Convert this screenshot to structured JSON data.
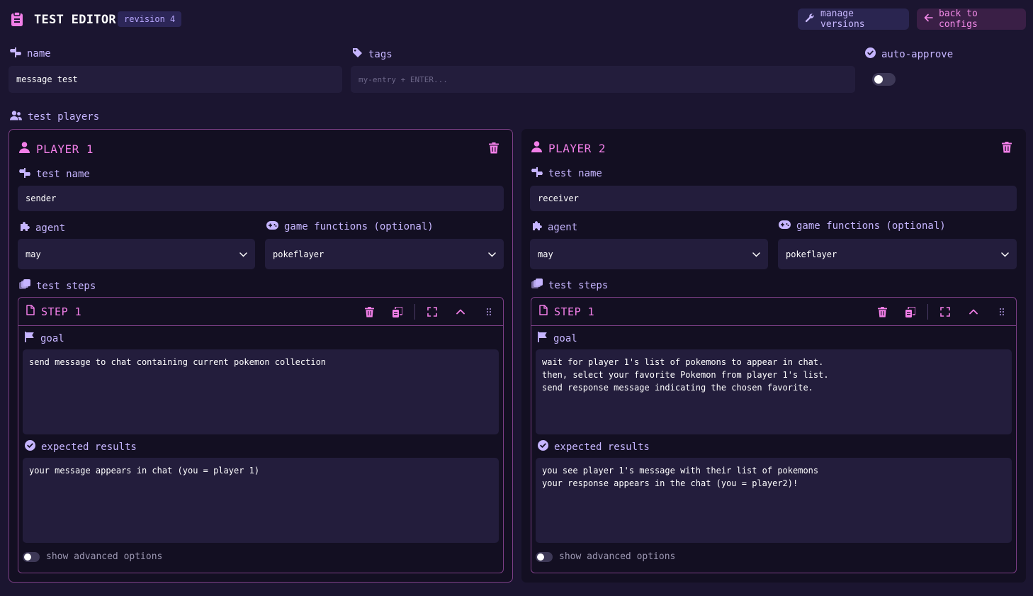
{
  "header": {
    "title": "TEST EDITOR",
    "revision": "revision 4",
    "manage_versions": "manage versions",
    "back_to_configs": "back to configs"
  },
  "form": {
    "name_label": "name",
    "name_value": "message test",
    "tags_label": "tags",
    "tags_placeholder": "my-entry + ENTER...",
    "auto_approve_label": "auto-approve",
    "auto_approve_on": false,
    "test_players_label": "test players"
  },
  "players": [
    {
      "title": "PLAYER 1",
      "test_name_label": "test name",
      "test_name": "sender",
      "agent_label": "agent",
      "agent": "may",
      "game_functions_label": "game functions (optional)",
      "game_functions": "pokeflayer",
      "test_steps_label": "test steps",
      "step_title": "STEP 1",
      "goal_label": "goal",
      "goal": "send message to chat containing current pokemon collection",
      "expected_label": "expected results",
      "expected": "your message appears in chat (you = player 1)",
      "advanced_label": "show advanced options"
    },
    {
      "title": "PLAYER 2",
      "test_name_label": "test name",
      "test_name": "receiver",
      "agent_label": "agent",
      "agent": "may",
      "game_functions_label": "game functions (optional)",
      "game_functions": "pokeflayer",
      "test_steps_label": "test steps",
      "step_title": "STEP 1",
      "goal_label": "goal",
      "goal": "wait for player 1's list of pokemons to appear in chat.\nthen, select your favorite Pokemon from player 1's list.\nsend response message indicating the chosen favorite.",
      "expected_label": "expected results",
      "expected": "you see player 1's message with their list of pokemons\nyour response appears in the chat (you = player2)!",
      "advanced_label": "show advanced options"
    }
  ],
  "colors": {
    "background": "#1b1530",
    "card": "#130f22",
    "field": "#231d3c",
    "accent_pink": "#f27fe8",
    "accent_lavender": "#c6b5ff"
  },
  "icons": {
    "clipboard": "clipboard-icon",
    "wrench": "wrench-icon",
    "arrow_left": "arrow-left-icon",
    "signpost": "signpost-icon",
    "tag": "tag-icon",
    "check_circle": "check-circle-icon",
    "users": "users-icon",
    "user": "user-icon",
    "trash": "trash-icon",
    "puzzle": "puzzle-icon",
    "gamepad": "gamepad-icon",
    "layers": "layers-icon",
    "file": "file-icon",
    "copy": "copy-icon",
    "expand": "expand-icon",
    "chevron_up": "chevron-up-icon",
    "grip": "grip-icon",
    "flag": "flag-icon",
    "chevron_down": "chevron-down-icon"
  }
}
